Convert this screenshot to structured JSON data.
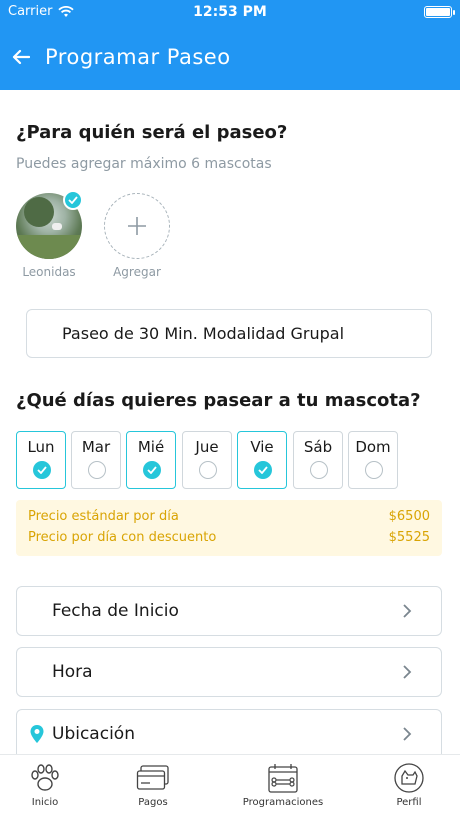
{
  "status_bar": {
    "carrier": "Carrier",
    "time": "12:53 PM"
  },
  "header": {
    "title": "Programar Paseo"
  },
  "pets_section": {
    "title": "¿Para quién será el paseo?",
    "subtitle": "Puedes agregar máximo 6 mascotas",
    "pets": [
      {
        "name": "Leonidas",
        "selected": true
      }
    ],
    "add_label": "Agregar"
  },
  "plan": {
    "label": "Paseo de 30 Min. Modalidad Grupal"
  },
  "days_section": {
    "title": "¿Qué días quieres pasear a tu mascota?",
    "days": [
      {
        "label": "Lun",
        "selected": true
      },
      {
        "label": "Mar",
        "selected": false
      },
      {
        "label": "Mié",
        "selected": true
      },
      {
        "label": "Jue",
        "selected": false
      },
      {
        "label": "Vie",
        "selected": true
      },
      {
        "label": "Sáb",
        "selected": false
      },
      {
        "label": "Dom",
        "selected": false
      }
    ]
  },
  "pricing": {
    "standard_label": "Precio estándar por día",
    "standard_value": "$6500",
    "discount_label": "Precio por día con descuento",
    "discount_value": "$5525"
  },
  "options": {
    "start_date": "Fecha de Inicio",
    "time": "Hora",
    "location": "Ubicación"
  },
  "nav": {
    "items": [
      {
        "label": "Inicio",
        "icon": "paw-icon"
      },
      {
        "label": "Pagos",
        "icon": "credit-card-icon"
      },
      {
        "label": "Programaciones",
        "icon": "calendar-bone-icon"
      },
      {
        "label": "Perfil",
        "icon": "profile-dog-icon"
      }
    ]
  },
  "colors": {
    "primary": "#2196f3",
    "accent": "#26c6da",
    "price_bg": "#fff8e1",
    "price_text": "#d9a404"
  }
}
